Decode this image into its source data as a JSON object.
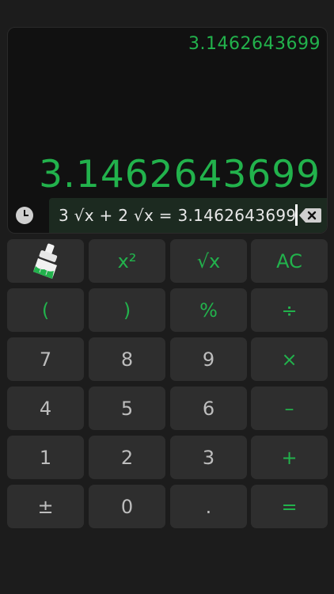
{
  "display": {
    "previous_result": "3.1462643699",
    "main_result": "3.1462643699",
    "expression": "3 √x + 2 √x = 3.1462643699"
  },
  "icons": {
    "history": "clock-icon",
    "backspace": "backspace-icon",
    "clear_history": "paint-brush-icon"
  },
  "colors": {
    "accent": "#22b24c",
    "background": "#1c1c1c",
    "display_bg": "#111111",
    "key_bg": "#2e2e2e",
    "digit_text": "#bdbdbd"
  },
  "keys": {
    "square": "x²",
    "sqrt": "√x",
    "clear": "AC",
    "open_paren": "(",
    "close_paren": ")",
    "percent": "%",
    "divide": "÷",
    "seven": "7",
    "eight": "8",
    "nine": "9",
    "multiply": "×",
    "four": "4",
    "five": "5",
    "six": "6",
    "minus": "–",
    "one": "1",
    "two": "2",
    "three": "3",
    "plus": "+",
    "plus_minus": "±",
    "zero": "0",
    "decimal": ".",
    "equals": "="
  }
}
